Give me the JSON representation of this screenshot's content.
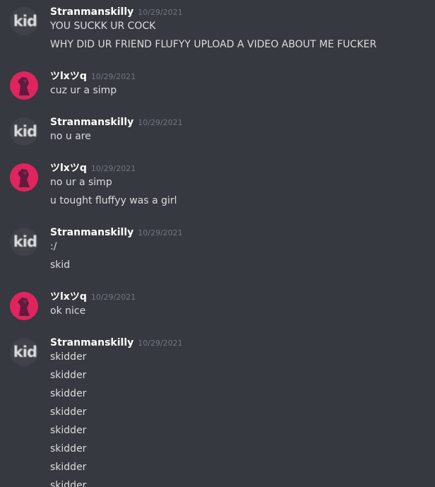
{
  "users": {
    "stranman": {
      "name": "Stranmanskilly",
      "avatar_text": "kid"
    },
    "lxq": {
      "name": "ツlxツq"
    }
  },
  "groups": [
    {
      "user": "Stranmanskilly",
      "timestamp": "10/29/2021",
      "messages": [
        "YOU SUCKK UR COCK",
        "WHY DID UR FRIEND FLUFYY UPLOAD A VIDEO ABOUT ME FUCKER"
      ]
    },
    {
      "user": "ツlxツq",
      "timestamp": "10/29/2021",
      "messages": [
        "cuz ur a simp"
      ]
    },
    {
      "user": "Stranmanskilly",
      "timestamp": "10/29/2021",
      "messages": [
        "no u are"
      ]
    },
    {
      "user": "ツlxツq",
      "timestamp": "10/29/2021",
      "messages": [
        "no ur a simp",
        "u tought fluffyy was a girl"
      ]
    },
    {
      "user": "Stranmanskilly",
      "timestamp": "10/29/2021",
      "messages": [
        ":/",
        "skid"
      ]
    },
    {
      "user": "ツlxツq",
      "timestamp": "10/29/2021",
      "messages": [
        "ok nice"
      ]
    },
    {
      "user": "Stranmanskilly",
      "timestamp": "10/29/2021",
      "messages": [
        "skidder",
        "skidder",
        "skidder",
        "skidder",
        "skidder",
        "skidder",
        "skidder",
        "skidder"
      ]
    }
  ],
  "colors": {
    "background": "#36393f",
    "username": "#ffffff",
    "timestamp": "#72767d",
    "message_text": "#dcddde",
    "pink_avatar": "#e0245e"
  }
}
